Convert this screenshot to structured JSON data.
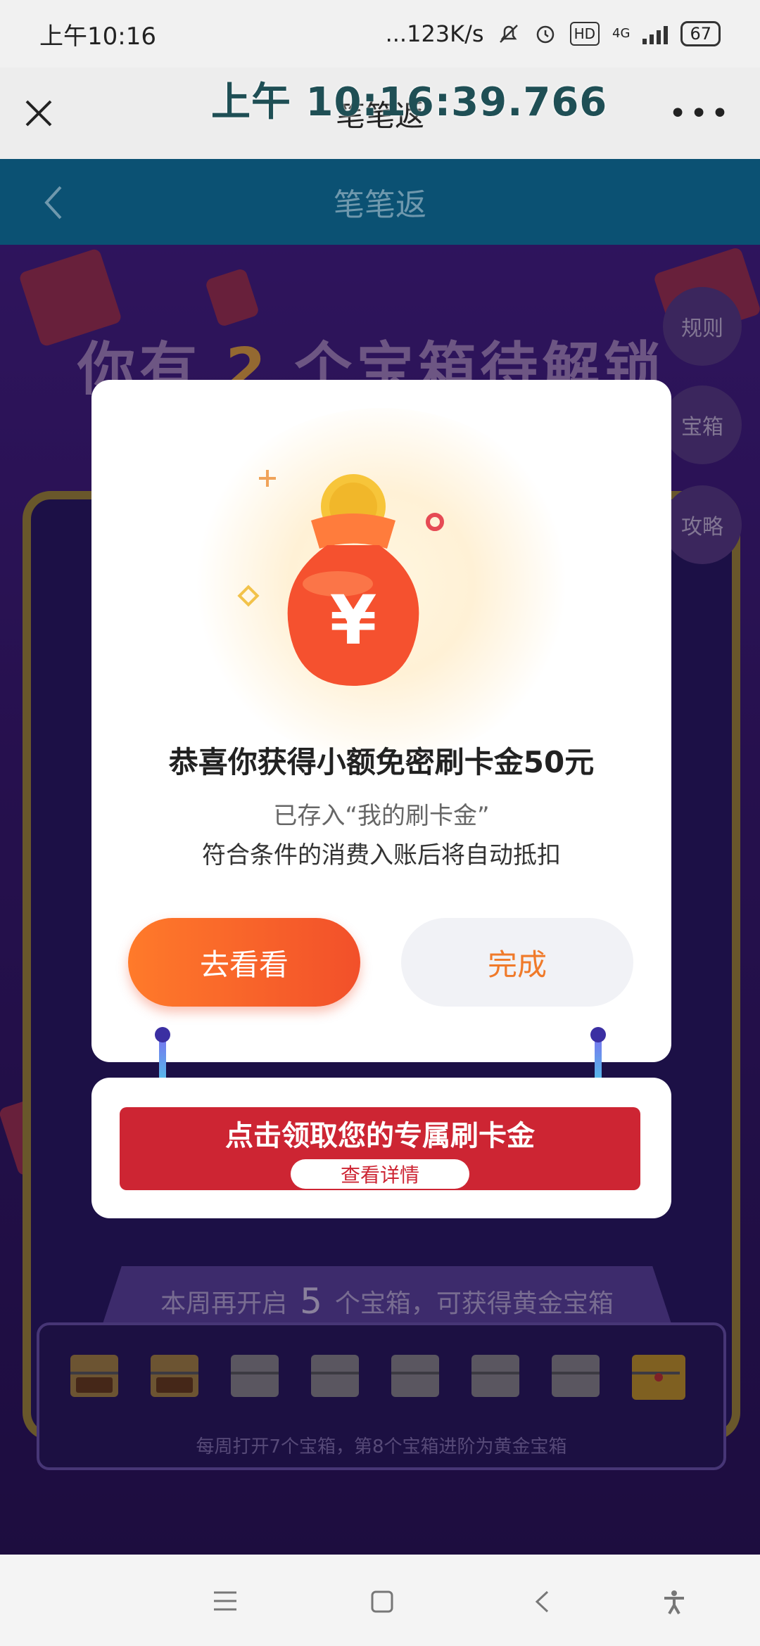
{
  "status_bar": {
    "time": "上午10:16",
    "net_speed": "...123K/s",
    "network": "4G",
    "hd": "HD",
    "battery": "67"
  },
  "screenshot_overlay": {
    "timestamp": "上午 10:16:39.766"
  },
  "wechat_bar": {
    "title": "笔笔返",
    "close_icon": "close-icon",
    "more_icon": "more-icon"
  },
  "app_header": {
    "title": "笔笔返",
    "back_icon": "back-arrow-icon"
  },
  "background": {
    "title_prefix": "你有",
    "title_count": "2",
    "title_suffix": "个宝箱待解锁",
    "side_buttons": [
      "规则",
      "宝箱",
      "攻略"
    ],
    "week_prefix": "本周再开启",
    "week_count": "5",
    "week_suffix": "个宝箱，可获得黄金宝箱",
    "week_note": "每周打开7个宝箱，第8个宝箱进阶为黄金宝箱",
    "chests": [
      "open",
      "open",
      "closed",
      "closed",
      "closed",
      "closed",
      "closed",
      "gold"
    ]
  },
  "modal": {
    "title": "恭喜你获得小额免密刷卡金50元",
    "sub1": "已存入“我的刷卡金”",
    "sub2": "符合条件的消费入账后将自动抵扣",
    "primary_button": "去看看",
    "secondary_button": "完成"
  },
  "banner": {
    "title": "点击领取您的专属刷卡金",
    "detail_button": "查看详情"
  },
  "colors": {
    "header_bg": "#0b5173",
    "primary_orange": "#f2502a",
    "banner_red": "#cd2533",
    "purple_bg": "#48208f"
  }
}
